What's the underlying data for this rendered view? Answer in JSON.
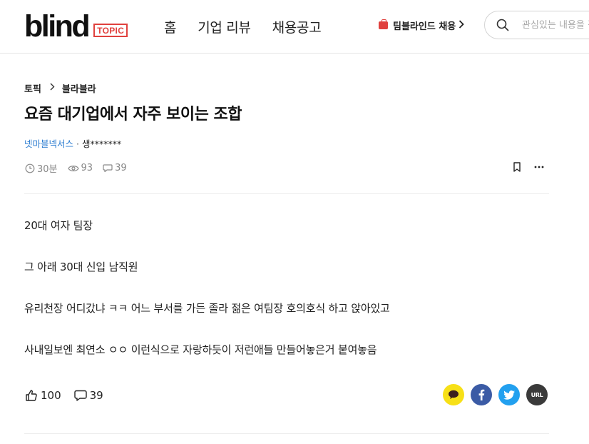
{
  "header": {
    "logo_word": "blind",
    "logo_badge": "TOPIC",
    "nav": [
      "홈",
      "기업 리뷰",
      "채용공고"
    ],
    "hire_label": "팀블라인드 채용",
    "search_placeholder": "관심있는 내용을 검색해보세요!",
    "accent_color": "#e0413e"
  },
  "post": {
    "breadcrumb": {
      "root": "토픽",
      "board": "블라블라"
    },
    "title": "요즘 대기업에서 자주 보이는 조합",
    "author": {
      "company": "넷마블넥서스",
      "separator": "·",
      "nickname": "생*******"
    },
    "meta": {
      "time": "30분",
      "views": "93",
      "comments": "39"
    },
    "body": [
      "20대 여자 팀장",
      "그 아래 30대 신입 남직원",
      "유리천장 어디갔냐 ㅋㅋ 어느 부서를 가든 졸라 젊은 여팀장 호의호식 하고 앉아있고",
      "사내일보엔 최연소 ㅇㅇ 이런식으로 자랑하듯이 저런애들 만들어놓은거 붙여놓음"
    ],
    "reactions": {
      "likes": "100",
      "comments": "39"
    },
    "share": {
      "kakao_icon": "kakao-talk-icon",
      "facebook_icon": "facebook-icon",
      "twitter_icon": "twitter-icon",
      "url_label": "URL",
      "colors": {
        "kakao": "#f7e017",
        "facebook": "#3b5ba5",
        "twitter": "#22a0ef",
        "url": "#3a3a3a"
      }
    },
    "link_color": "#2b7cd0"
  }
}
